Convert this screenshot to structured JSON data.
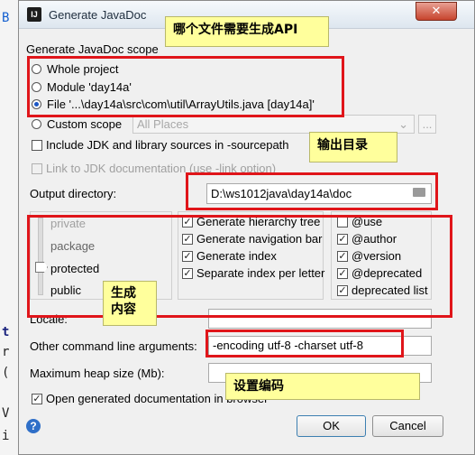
{
  "editor": {
    "gutter_glyphs": [
      "B",
      "t",
      "r",
      "(",
      "V",
      "i"
    ]
  },
  "dialog": {
    "title": "Generate JavaDoc",
    "close_glyph": "✕",
    "scope": {
      "legend": "Generate JavaDoc scope",
      "options": [
        "Whole project",
        "Module 'day14a'",
        "File '...\\day14a\\src\\com\\util\\ArrayUtils.java [day14a]'",
        "Custom scope"
      ],
      "selected_index": 2,
      "custom_scope_value": "All Places",
      "more_button": "..."
    },
    "include_jdk": {
      "label": "Include JDK and library sources in -sourcepath",
      "checked": false
    },
    "link_jdk": {
      "label": "Link to JDK documentation (use -link option)",
      "checked": false
    },
    "output_dir": {
      "label": "Output directory:",
      "value": "D:\\ws1012java\\day14a\\doc"
    },
    "visibility": {
      "levels": [
        "private",
        "package",
        "protected",
        "public"
      ],
      "selected": "protected"
    },
    "generate_options": [
      {
        "label": "Generate hierarchy tree",
        "checked": true
      },
      {
        "label": "Generate navigation bar",
        "checked": true
      },
      {
        "label": "Generate index",
        "checked": true
      },
      {
        "label": "Separate index per letter",
        "checked": true
      }
    ],
    "tag_options": [
      {
        "label": "@use",
        "checked": false
      },
      {
        "label": "@author",
        "checked": true
      },
      {
        "label": "@version",
        "checked": true
      },
      {
        "label": "@deprecated",
        "checked": true
      },
      {
        "label": "deprecated list",
        "checked": true
      }
    ],
    "locale": {
      "label": "Locale:",
      "value": ""
    },
    "other_args": {
      "label": "Other command line arguments:",
      "value": "-encoding utf-8 -charset utf-8"
    },
    "max_heap": {
      "label": "Maximum heap size (Mb):",
      "value": ""
    },
    "open_in_browser": {
      "label": "Open generated documentation in browser",
      "checked": true
    },
    "help": "?",
    "ok": "OK",
    "cancel": "Cancel"
  },
  "annotations": {
    "scope_note": "哪个文件需要生成API",
    "output_note": "输出目录",
    "content_note_line1": "生成",
    "content_note_line2": "内容",
    "encoding_note": "设置编码"
  },
  "colors": {
    "annotation_border": "#e0151a",
    "annotation_fill": "#ffff9c",
    "accent": "#2f6fc8"
  }
}
